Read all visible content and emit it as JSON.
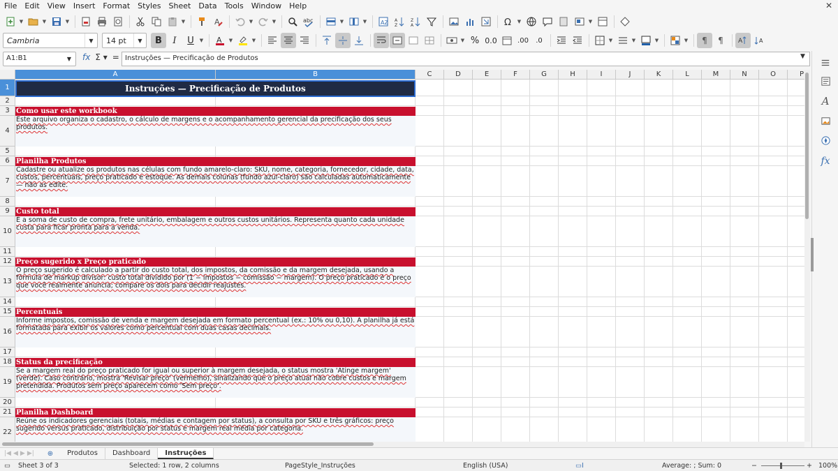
{
  "menu": [
    "File",
    "Edit",
    "View",
    "Insert",
    "Format",
    "Styles",
    "Sheet",
    "Data",
    "Tools",
    "Window",
    "Help"
  ],
  "font": {
    "name": "Cambria",
    "size": "14 pt"
  },
  "namebox": "A1:B1",
  "formula": "Instruções — Precificação de Produtos",
  "columns": [
    "A",
    "B",
    "C",
    "D",
    "E",
    "F",
    "G",
    "H",
    "I",
    "J",
    "K",
    "L",
    "M",
    "N",
    "O",
    "P"
  ],
  "rows": [
    "1",
    "2",
    "3",
    "4",
    "5",
    "6",
    "7",
    "8",
    "9",
    "10",
    "11",
    "12",
    "13",
    "14",
    "15",
    "16",
    "17",
    "18",
    "19",
    "20",
    "21",
    "22"
  ],
  "title": "Instruções — Precificação de Produtos",
  "sections": [
    {
      "header": "Como usar este workbook",
      "body": "Este arquivo organiza o cadastro, o cálculo de margens e o acompanhamento gerencial da precificação dos seus produtos."
    },
    {
      "header": "Planilha Produtos",
      "body": "Cadastre ou atualize os produtos nas células com fundo amarelo-claro: SKU, nome, categoria, fornecedor, cidade, data, custos, percentuais, preço praticado e estoque. As demais colunas (fundo azul-claro) são calculadas automaticamente — não as edite."
    },
    {
      "header": "Custo total",
      "body": "É a soma de custo de compra, frete unitário, embalagem e outros custos unitários. Representa quanto cada unidade custa para ficar pronta para a venda."
    },
    {
      "header": "Preço sugerido x Preço praticado",
      "body": "O preço sugerido é calculado a partir do custo total, dos impostos, da comissão e da margem desejada, usando a fórmula de markup divisor: custo total dividido por (1 − impostos − comissão − margem). O preço praticado é o preço que você realmente anuncia; compare os dois para decidir reajustes."
    },
    {
      "header": "Percentuais",
      "body": "Informe impostos, comissão de venda e margem desejada em formato percentual (ex.: 10% ou 0,10). A planilha já está formatada para exibir os valores como percentual com duas casas decimais."
    },
    {
      "header": "Status da precificação",
      "body": "Se a margem real do preço praticado for igual ou superior à margem desejada, o status mostra 'Atinge margem' (verde). Caso contrário, mostra 'Revisar preço' (vermelho), sinalizando que o preço atual não cobre custos e margem pretendida. Produtos sem preço aparecem como 'Sem preço'."
    },
    {
      "header": "Planilha Dashboard",
      "body": "Reúne os indicadores gerenciais (totais, médias e contagem por status), a consulta por SKU e três gráficos: preço sugerido versus praticado, distribuição por status e margem real média por categoria."
    }
  ],
  "tabs": [
    "Produtos",
    "Dashboard",
    "Instruções"
  ],
  "status": {
    "sheet": "Sheet 3 of 3",
    "selection": "Selected: 1 row, 2 columns",
    "pagestyle": "PageStyle_Instruções",
    "language": "English (USA)",
    "sum": "Average: ; Sum: 0",
    "zoom": "100%"
  }
}
